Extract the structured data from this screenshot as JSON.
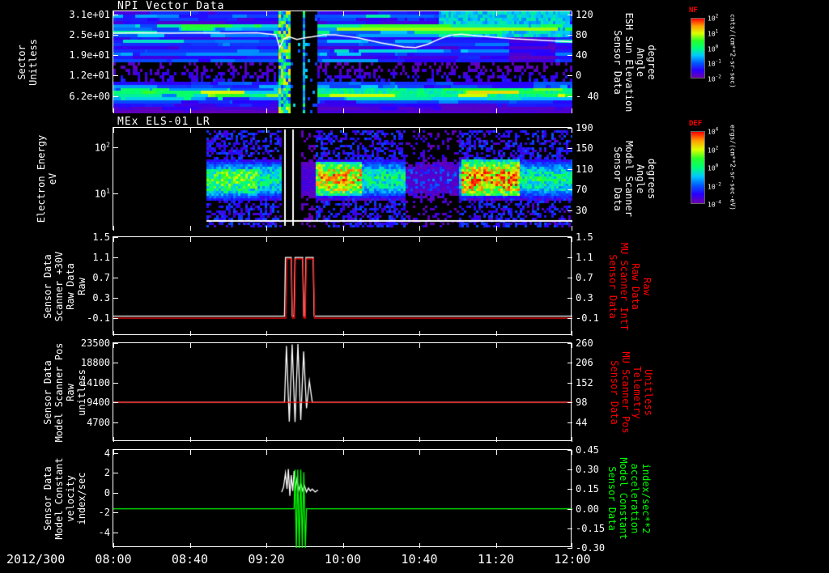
{
  "colors": {
    "background": "#000000",
    "axis_text": "#ffffff",
    "red_series": "#ff0000",
    "green_series": "#00ff00",
    "colorbar_label": "#ff0000"
  },
  "x_axis": {
    "date_label": "2012/300",
    "tick_labels": [
      "08:00",
      "08:40",
      "09:20",
      "10:00",
      "10:40",
      "11:20",
      "12:00"
    ]
  },
  "panels": [
    {
      "title": "NPI Vector Data",
      "left_label": [
        "Sector",
        "Unitless"
      ],
      "left_ticks": [
        "3.1e+01",
        "2.5e+01",
        "1.9e+01",
        "1.2e+01",
        "6.2e+00"
      ],
      "right_ticks": [
        "120",
        "80",
        "40",
        "0",
        "- 40"
      ],
      "right_label": [
        "Sensor Data",
        "ESH Sun Elevation",
        "Angle",
        "degree"
      ],
      "colorbar": {
        "title": "NF",
        "tick_labels": [
          "10^2",
          "10^1",
          "10^0",
          "10^-1",
          "10^-2"
        ],
        "units": "cnts/(cm**2-sr-sec)"
      }
    },
    {
      "title": "MEx ELS-01 LR",
      "left_label": [
        "Electron Energy",
        "eV"
      ],
      "left_ticks": [
        "10^2",
        "10^1"
      ],
      "right_ticks": [
        "190",
        "150",
        "110",
        "70",
        "30"
      ],
      "right_label": [
        "Sensor Data",
        "Model Scanner",
        "Angle",
        "degrees"
      ],
      "colorbar": {
        "title": "DEF",
        "tick_labels": [
          "10^4",
          "10^2",
          "10^0",
          "10^-2",
          "10^-4"
        ],
        "units": "ergs/(cm**2-sr-sec-eV)"
      }
    },
    {
      "left_label": [
        "Sensor Data",
        "Scanner +30V",
        "Raw Data",
        "Raw"
      ],
      "left_ticks": [
        "1.5",
        "1.1",
        "0.7",
        "0.3",
        "-0.1"
      ],
      "right_ticks": [
        "1.5",
        "1.1",
        "0.7",
        "0.3",
        "-0.1"
      ],
      "right_label": [
        "Sensor Data",
        "MU Scanner IntT",
        "Raw Data",
        "Raw"
      ]
    },
    {
      "left_label": [
        "Sensor Data",
        "Model Scanner Pos",
        "Raw",
        "unitless"
      ],
      "left_ticks": [
        "23500",
        "18800",
        "14100",
        "9400",
        "4700"
      ],
      "right_ticks": [
        "260",
        "206",
        "152",
        "98",
        "44"
      ],
      "right_label": [
        "Sensor Data",
        "MU Scanner Pos",
        "Telemetry",
        "Unitless"
      ]
    },
    {
      "left_label": [
        "Sensor Data",
        "Model Constant",
        "velocity",
        "index/sec"
      ],
      "left_ticks": [
        "4",
        "2",
        "0",
        "-2",
        "-4"
      ],
      "right_ticks": [
        "0.45",
        "0.30",
        "0.15",
        "0.00",
        "-0.15",
        "-0.30"
      ],
      "right_label": [
        "Sensor Data",
        "Model Constant",
        "acceleration",
        "index/sec**2"
      ]
    }
  ],
  "chart_data": [
    {
      "type": "heatmap",
      "title": "NPI Vector Data",
      "ylabel": "Sector (Unitless)",
      "y_tick_values": [
        31,
        25,
        19,
        12,
        6.2
      ],
      "x_unit": "minutes after 08:00 on day 2012/300",
      "x_range": [
        0,
        240
      ],
      "colorbar_title": "NF",
      "colorbar_units": "cnts/(cm**2-sr-sec)",
      "features": "32-sector ion count spectrogram; mostly blue/purple horizontal bands; dark/purple band in lower middle sectors; bright cyan band near bottom sectors; bright cyan patch upper right 11:00-12:00; multicolor burst ~09:27 followed by black data gap ~09:30-09:46",
      "overlay_ylim": [
        -74,
        126
      ],
      "overlay_series": {
        "name": "Sensor Data ESH Sun Elevation Angle (degrees, right axis)",
        "points": [
          [
            0,
            83
          ],
          [
            15,
            84
          ],
          [
            30,
            83
          ],
          [
            45,
            84
          ],
          [
            60,
            83
          ],
          [
            75,
            84
          ],
          [
            85,
            80
          ],
          [
            87,
            55
          ],
          [
            89,
            72
          ],
          [
            92,
            76
          ],
          [
            96,
            71
          ],
          [
            100,
            74
          ],
          [
            104,
            76
          ],
          [
            110,
            80
          ],
          [
            116,
            80
          ],
          [
            122,
            77
          ],
          [
            128,
            74
          ],
          [
            134,
            69
          ],
          [
            140,
            64
          ],
          [
            146,
            60
          ],
          [
            152,
            56
          ],
          [
            158,
            55
          ],
          [
            164,
            61
          ],
          [
            170,
            71
          ],
          [
            176,
            79
          ],
          [
            182,
            81
          ],
          [
            190,
            78
          ],
          [
            200,
            75
          ],
          [
            210,
            72
          ],
          [
            220,
            70
          ],
          [
            230,
            68
          ],
          [
            240,
            66
          ]
        ]
      }
    },
    {
      "type": "heatmap",
      "title": "MEx ELS-01 LR",
      "ylabel": "Electron Energy (eV)",
      "y_scale": "log",
      "y_tick_values": [
        100,
        10
      ],
      "x_unit": "minutes after 08:00",
      "x_range": [
        0,
        240
      ],
      "data_start_minute": 49,
      "right_axis_ticks": [
        190,
        150,
        110,
        70,
        30
      ],
      "colorbar_title": "DEF",
      "colorbar_units": "ergs/(cm**2-sr-sec-eV)",
      "features": "electron energy-time spectrogram; intense 10-50 eV green/yellow band; hottest red blobs ~09:45-10:10 and ~11:00-11:25; instrument gap with two white vertical marker lines 09:29-09:38; weak flux 10:32-10:58; thin white trace along bottom of data region"
    },
    {
      "type": "line",
      "ylim_left": [
        -0.45,
        1.5
      ],
      "series": [
        {
          "name": "Sensor Data Scanner +30V Raw Data Raw",
          "color": "#ffffff",
          "axis": "left",
          "points": [
            [
              0,
              -0.06
            ],
            [
              89.5,
              -0.06
            ],
            [
              90,
              1.1
            ],
            [
              93,
              1.1
            ],
            [
              93.5,
              -0.06
            ],
            [
              94.5,
              -0.06
            ],
            [
              95,
              1.1
            ],
            [
              99,
              1.1
            ],
            [
              99.5,
              -0.06
            ],
            [
              100.2,
              -0.06
            ],
            [
              100.7,
              1.1
            ],
            [
              104.5,
              1.1
            ],
            [
              105,
              -0.06
            ],
            [
              240,
              -0.06
            ]
          ]
        },
        {
          "name": "Sensor Data MU Scanner IntT Raw Data Raw",
          "color": "#ff0000",
          "axis": "left",
          "points": [
            [
              0,
              -0.1
            ],
            [
              90.2,
              -0.1
            ],
            [
              90.7,
              1.07
            ],
            [
              93.2,
              1.07
            ],
            [
              93.7,
              -0.1
            ],
            [
              94.7,
              -0.1
            ],
            [
              95.2,
              1.07
            ],
            [
              99.2,
              1.07
            ],
            [
              99.7,
              -0.1
            ],
            [
              100.4,
              -0.1
            ],
            [
              100.9,
              1.07
            ],
            [
              104.7,
              1.07
            ],
            [
              105.2,
              -0.1
            ],
            [
              240,
              -0.1
            ]
          ]
        }
      ]
    },
    {
      "type": "line",
      "ylim_left": [
        0,
        23500
      ],
      "ylim_right": [
        -10,
        260
      ],
      "series": [
        {
          "name": "Sensor Data Model Scanner Pos Raw (unitless)",
          "color": "#ffffff",
          "axis": "left",
          "points": [
            [
              0,
              9400
            ],
            [
              89.5,
              9400
            ],
            [
              90.5,
              22800
            ],
            [
              92,
              4800
            ],
            [
              93.5,
              23200
            ],
            [
              95,
              4700
            ],
            [
              96.5,
              23300
            ],
            [
              98,
              5200
            ],
            [
              99.5,
              21500
            ],
            [
              101,
              8000
            ],
            [
              102.5,
              14500
            ],
            [
              104,
              9400
            ],
            [
              240,
              9400
            ]
          ]
        },
        {
          "name": "Sensor Data MU Scanner Pos Telemetry (Unitless)",
          "color": "#ff0000",
          "axis": "left",
          "points": [
            [
              0,
              9400
            ],
            [
              240,
              9400
            ]
          ]
        }
      ]
    },
    {
      "type": "line",
      "ylim_left": [
        -5.52,
        4.32
      ],
      "ylim_right": [
        -0.3,
        0.45
      ],
      "series": [
        {
          "name": "Sensor Data Model Constant velocity (index/sec)",
          "color": "#ffffff",
          "axis": "left",
          "points": [
            [
              88,
              0.1
            ],
            [
              89,
              0.6
            ],
            [
              90,
              2.0
            ],
            [
              90.8,
              0.4
            ],
            [
              91.5,
              2.4
            ],
            [
              92.3,
              -0.3
            ],
            [
              93,
              1.8
            ],
            [
              93.8,
              0.2
            ],
            [
              94.5,
              2.2
            ],
            [
              95.3,
              0.5
            ],
            [
              96,
              1.4
            ],
            [
              97,
              0.3
            ],
            [
              98,
              1.0
            ],
            [
              99,
              0.2
            ],
            [
              100,
              0.7
            ],
            [
              101,
              0.1
            ],
            [
              102,
              0.5
            ],
            [
              103,
              0.2
            ],
            [
              104,
              0.4
            ],
            [
              105.5,
              0.1
            ],
            [
              107,
              0.3
            ]
          ]
        },
        {
          "name": "Sensor Data Model Constant acceleration (index/sec**2)",
          "color": "#00ff00",
          "axis": "right",
          "points": [
            [
              0,
              0
            ],
            [
              94.5,
              0
            ],
            [
              95,
              0.3
            ],
            [
              95.7,
              -0.32
            ],
            [
              96.4,
              0.3
            ],
            [
              97.2,
              -0.33
            ],
            [
              98,
              0.3
            ],
            [
              98.8,
              -0.3
            ],
            [
              99.6,
              0.28
            ],
            [
              100.4,
              -0.3
            ],
            [
              101,
              0
            ],
            [
              240,
              0
            ]
          ]
        }
      ]
    }
  ]
}
